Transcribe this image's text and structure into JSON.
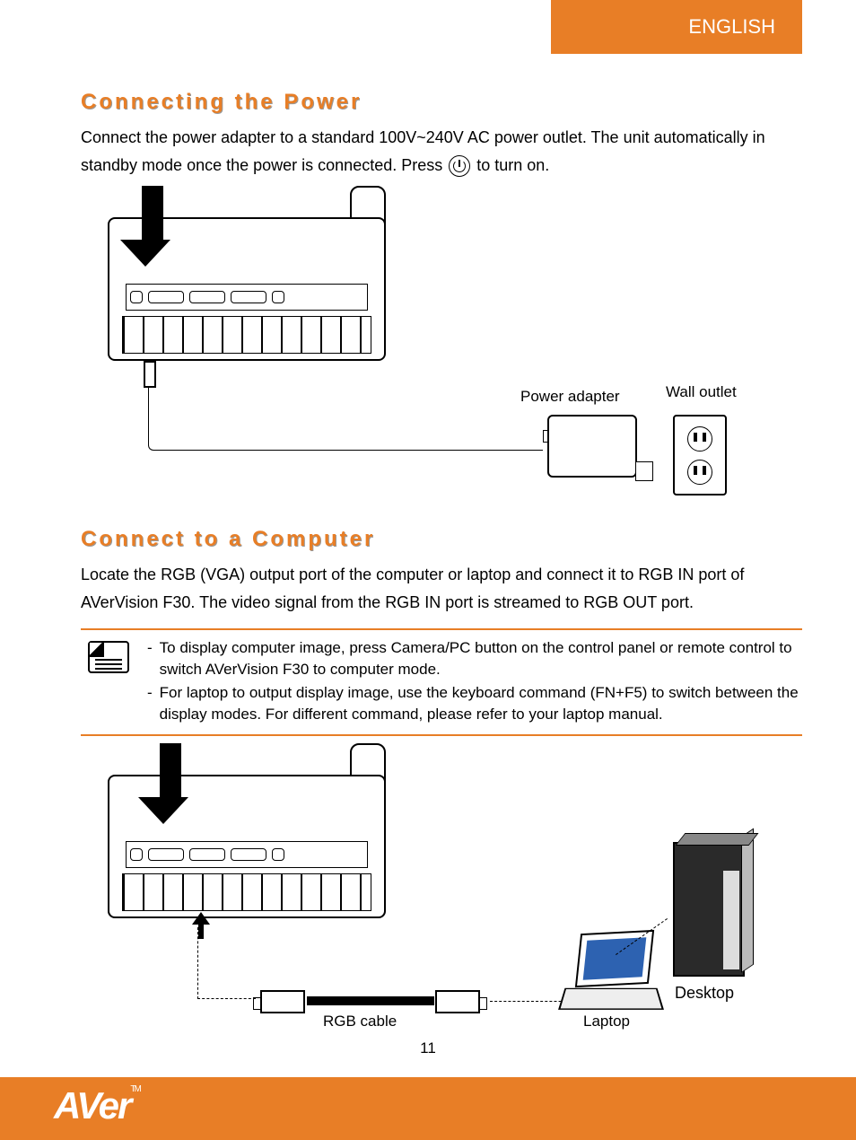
{
  "language_tab": "ENGLISH",
  "section1": {
    "title": "Connecting the Power",
    "para_before": "Connect the power adapter to a standard 100V~240V AC power outlet. The unit automatically in standby mode once the power is connected. Press ",
    "para_after": " to turn on.",
    "label_adapter": "Power adapter",
    "label_outlet": "Wall outlet"
  },
  "section2": {
    "title": "Connect to a Computer",
    "para": "Locate the RGB (VGA) output port of the computer or laptop and connect it to RGB IN port of AVerVision F30. The video signal from the RGB IN port is streamed to RGB OUT port.",
    "notes": [
      "To display computer image, press Camera/PC button on the control panel or remote control to switch AVerVision F30 to computer mode.",
      "For laptop to output display image, use the keyboard command (FN+F5) to switch between the display modes. For different command, please refer to your laptop manual."
    ],
    "label_rgb": "RGB cable",
    "label_laptop": "Laptop",
    "label_desktop": "Desktop"
  },
  "page_number": "11",
  "logo": {
    "text": "AVer",
    "tm": "TM"
  }
}
